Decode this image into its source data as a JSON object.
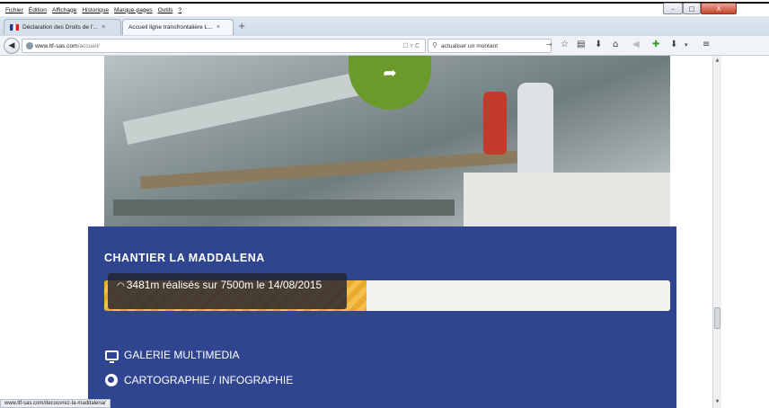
{
  "menubar": {
    "items": [
      "Fichier",
      "Édition",
      "Affichage",
      "Historique",
      "Marque-pages",
      "Outils",
      "?"
    ]
  },
  "tabs": [
    {
      "label": "Déclaration des Droits de l'...",
      "close": "×"
    },
    {
      "label": "Accueil ligne transfrontalière L...",
      "close": "×"
    }
  ],
  "newtab_symbol": "+",
  "navbar": {
    "url_host": "www.ltf-sas.com",
    "url_path": "/accueil/",
    "search_value": "actualiser un montant",
    "url_icons": "☐ ▿ C",
    "go_symbol": "→"
  },
  "window_controls": {
    "minimize": "–",
    "maximize": "□",
    "close": "X"
  },
  "hero": {
    "share_symbol": "➦"
  },
  "panel": {
    "title": "CHANTIER LA MADDALENA",
    "progress": {
      "current_m": 3481,
      "total_m": 7500,
      "fraction": 0.464,
      "label": "3481m réalisés sur 7500m le 14/08/2015"
    },
    "links": [
      {
        "label": "GALERIE MULTIMEDIA",
        "icon": "monitor-icon"
      },
      {
        "label": "CARTOGRAPHIE / INFOGRAPHIE",
        "icon": "globe-icon"
      }
    ]
  },
  "status_url": "www.ltf-sas.com/decouvrez-la-maddalena/",
  "colors": {
    "panel_bg": "#2f4590",
    "progress_fill": "#e8a92c",
    "hero_circle": "#6a9a2c"
  }
}
